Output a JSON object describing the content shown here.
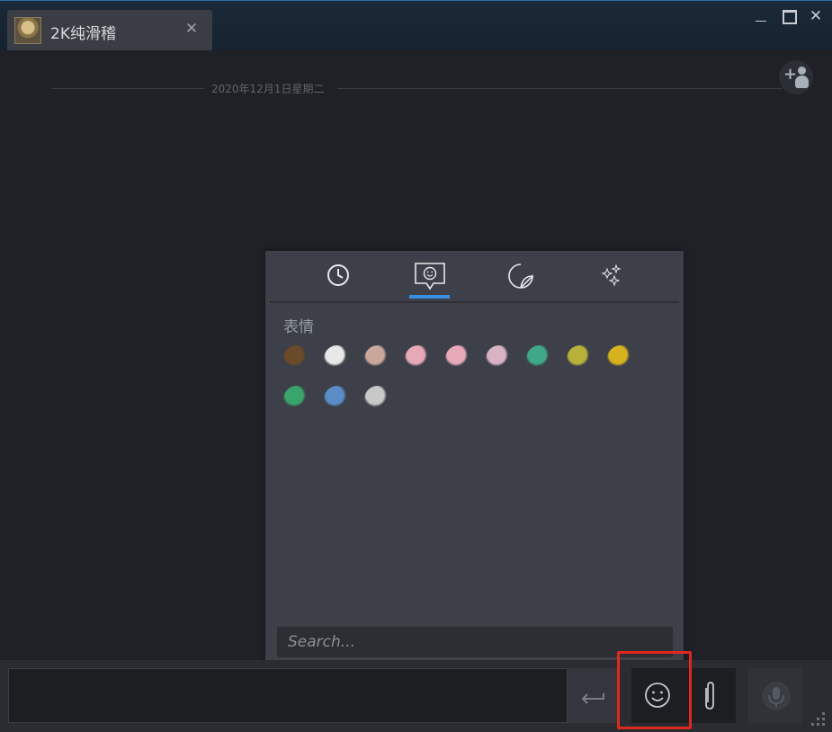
{
  "tab": {
    "title": "2K纯滑稽",
    "close_glyph": "✕"
  },
  "window_controls": {
    "close_glyph": "✕"
  },
  "chat": {
    "date_separator": "2020年12月1日星期二"
  },
  "emoji_picker": {
    "tabs": [
      {
        "icon": "clock-icon",
        "active": false
      },
      {
        "icon": "speech-bubble-smiley-icon",
        "active": true
      },
      {
        "icon": "sticker-icon",
        "active": false
      },
      {
        "icon": "sparkles-icon",
        "active": false
      }
    ],
    "section_title": "表情",
    "emoticons": [
      {
        "name": "poop-emoji",
        "color": "#6b4a2a"
      },
      {
        "name": "thumbs-up-emoji",
        "color": "#e8e8e8"
      },
      {
        "name": "seal-emoji",
        "color": "#c9a79a"
      },
      {
        "name": "pig-hat-emoji",
        "color": "#e7a9b8"
      },
      {
        "name": "pig-hat-2-emoji",
        "color": "#e7a9b8"
      },
      {
        "name": "pig-sleeping-emoji",
        "color": "#d8b3c4"
      },
      {
        "name": "green-monster-sleep-emoji",
        "color": "#3fa886"
      },
      {
        "name": "yellow-monster-angry-emoji",
        "color": "#b8b23a"
      },
      {
        "name": "yellow-monster-shout-emoji",
        "color": "#d6b21e"
      },
      {
        "name": "green-monster-tongue-emoji",
        "color": "#39a56a"
      },
      {
        "name": "blue-monster-emoji",
        "color": "#5a8cc8"
      },
      {
        "name": "sword-emoji",
        "color": "#c8c8c8"
      }
    ],
    "search_placeholder": "Search..."
  },
  "composer": {
    "send_glyph": "↵"
  },
  "colors": {
    "accent": "#3b8fe0",
    "highlight": "#e0281e",
    "background": "#1f2126",
    "popup": "#3d4048"
  }
}
